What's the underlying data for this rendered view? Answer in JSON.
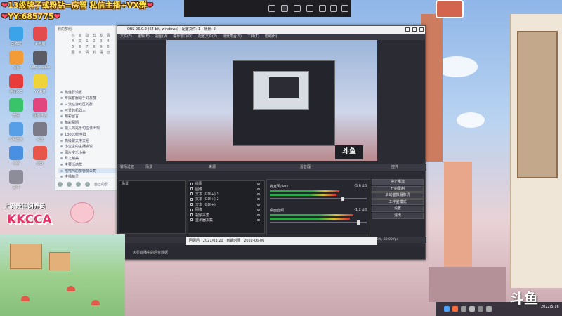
{
  "overlay": {
    "line1": "13级牌子或粉钻=房管 私信主播+VX群",
    "line2": "YY:685775",
    "heart": "❤",
    "follow_text": "上周最佳饲养员",
    "kkcca": "KKCCA"
  },
  "obs": {
    "title": "OBS 26.0.2 (64-bit, windows) - 配置文件: 1 - 场景: 2",
    "menu": [
      "文件(F)",
      "编辑(E)",
      "视图(V)",
      "停靠窗口(D)",
      "配置文件(P)",
      "场景集合(S)",
      "工具(T)",
      "帮助(H)"
    ],
    "dock_scene_label": "转场过渡",
    "dock_sources_label": "来源",
    "dock_mixer_label": "混音器",
    "dock_controls_label": "控件",
    "scenes_header": "场景",
    "scenes": [
      "场景"
    ],
    "sources": [
      "绘图",
      "图像",
      "文本 (GDI+) 3",
      "文本 (GDI+) 2",
      "文本 (GDI+)",
      "图像",
      "视频采集",
      "显示器采集"
    ],
    "mixer": [
      {
        "name": "麦克风/Aux",
        "db": "-5.6 dB",
        "level": 0.72,
        "volume": 0.74
      },
      {
        "name": "桌面音频",
        "db": "-1.2 dB",
        "level": 0.86,
        "volume": 0.9
      }
    ],
    "controls": [
      "停止推流",
      "开始录制",
      "启动虚拟摄像机",
      "工作室模式",
      "设置",
      "退出"
    ],
    "status": "LIVE: 12:33  00:00:00  REC: 00:00:00  CPU: 1.0%, 60.00 fps",
    "file_left": "回顾后",
    "file_mid": "2021/03/20",
    "file_label": "到期时间",
    "file_date": "2022-06-06",
    "lower_note": "火星直播中的后台数据"
  },
  "chat": {
    "header": "我的群组",
    "keypad": [
      "小",
      "窗",
      "隐",
      "剪",
      "发",
      "清",
      "A",
      "文",
      "1",
      "2",
      "3",
      "4",
      "5",
      "6",
      "7",
      "8",
      "9",
      "0",
      "图",
      "表",
      "情",
      "发",
      "语",
      "音"
    ],
    "items": [
      "最佳群设置",
      "专属客服助手好友群",
      "三流在游戏区的群",
      "可爱的机器人",
      "精彩留言",
      "精彩瞬间",
      "输入的是乐句应该出现",
      "13000粉丝群",
      "高级聊天中文组",
      "小宝宝的主播会说",
      "图片宝乐小盖",
      "月之精美",
      "主要活动群",
      "喵喵叫的群管员公司",
      "主播精灵"
    ],
    "footer": "自己的群"
  },
  "desktop": {
    "labels": [
      "回收站",
      "此电脑",
      "斗鱼",
      "OBS Studio",
      "腾讯QQ",
      "YY语音",
      "微信",
      "直播伴侣",
      "控制面板",
      "设置",
      "网络",
      "游戏",
      "文件"
    ]
  },
  "brand": {
    "douyu": "斗鱼",
    "clock_time": "",
    "clock_date": "2022/5/16"
  },
  "colors": {
    "accent": "#ffe44d",
    "kkcca": "#e4356b",
    "obs_bg": "#2b2b33"
  }
}
